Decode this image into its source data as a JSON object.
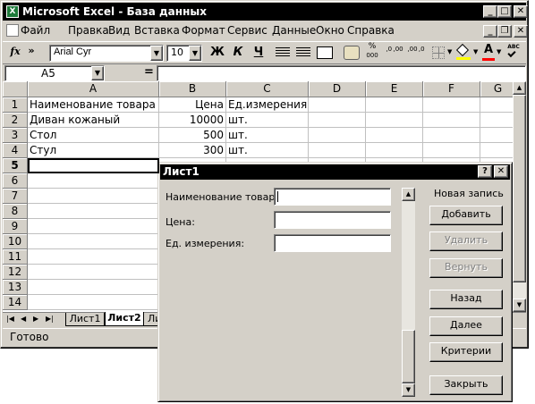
{
  "window": {
    "title": "Microsoft Excel - База данных",
    "min": "_",
    "max": "□",
    "close": "✕"
  },
  "doc_controls": {
    "min": "_",
    "restore": "❐",
    "close": "✕"
  },
  "menu": [
    "Файл",
    "Правка",
    "Вид",
    "Вставка",
    "Формат",
    "Сервис",
    "Данные",
    "Окно",
    "Справка"
  ],
  "toolbar": {
    "fx": "fx",
    "more": "»",
    "font": "Arial Cyr",
    "size": "10",
    "bold": "Ж",
    "italic": "К",
    "underline": "Ч",
    "percent": "%",
    "thousands": "000",
    "inc_decimal": ",0 ,00",
    "dec_decimal": ",00 ,0",
    "font_color": "A",
    "spell": "ABC"
  },
  "formula_bar": {
    "name_box": "A5",
    "equals": "=",
    "value": ""
  },
  "columns": [
    "A",
    "B",
    "C",
    "D",
    "E",
    "F",
    "G"
  ],
  "rows": [
    "1",
    "2",
    "3",
    "4",
    "5",
    "6",
    "7",
    "8",
    "9",
    "10",
    "11",
    "12",
    "13",
    "14"
  ],
  "cells": {
    "A1": "Наименование товара",
    "B1": "Цена",
    "C1": "Ед.измерения",
    "A2": "Диван кожаный",
    "B2": "10000",
    "C2": "шт.",
    "A3": "Стол",
    "B3": "500",
    "C3": "шт.",
    "A4": "Стул",
    "B4": "300",
    "C4": "шт."
  },
  "sheet_tabs": [
    "Лист1",
    "Лист2",
    "Ли"
  ],
  "status": "Готово",
  "form": {
    "title": "Лист1",
    "help": "?",
    "close": "✕",
    "fields": [
      {
        "label": "Наименование товара:",
        "value": ""
      },
      {
        "label": "Цена:",
        "value": ""
      },
      {
        "label": "Ед. измерения:",
        "value": ""
      }
    ],
    "record_status": "Новая запись",
    "buttons": {
      "new": "Добавить",
      "delete": "Удалить",
      "restore": "Вернуть",
      "prev": "Назад",
      "next": "Далее",
      "criteria": "Критерии",
      "close": "Закрыть"
    }
  }
}
